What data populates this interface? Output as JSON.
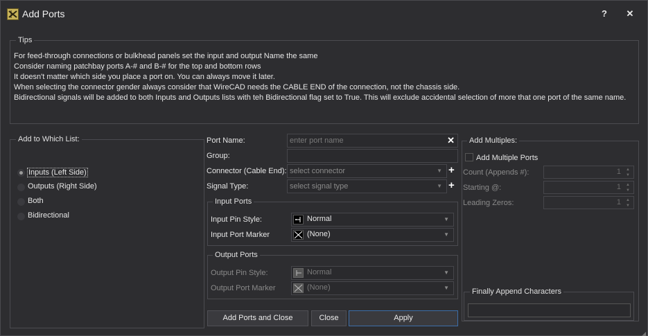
{
  "window": {
    "title": "Add Ports",
    "help": "?",
    "close": "✕"
  },
  "tips": {
    "title": "Tips",
    "lines": [
      "For feed-through connections or bulkhead panels set the input and output Name the same",
      "Consider naming patchbay ports A-# and B-# for the top and bottom rows",
      "It doesn't matter which side you place a port on. You can always move it later.",
      "When selecting the connector gender always consider that WireCAD needs the CABLE END of the connection, not the chassis side.",
      "Bidirectional signals will be added to both Inputs and Outputs lists with teh Bidirectional flag set to True. This will exclude accidental selection of more that one port of the same name."
    ]
  },
  "add_list": {
    "title": "Add to Which List:",
    "options": [
      "Inputs (Left Side)",
      "Outputs (Right Side)",
      "Both",
      "Bidirectional"
    ],
    "selected": "Inputs (Left Side)"
  },
  "form": {
    "port_name_label": "Port Name:",
    "port_name_placeholder": "enter port name",
    "group_label": "Group:",
    "connector_label": "Connector (Cable End):",
    "connector_placeholder": "select connector",
    "signal_label": "Signal Type:",
    "signal_placeholder": "select signal type",
    "clear": "✕",
    "add": "+"
  },
  "input_ports": {
    "title": "Input Ports",
    "pin_style_label": "Input Pin Style:",
    "pin_style_value": "Normal",
    "marker_label": "Input Port Marker",
    "marker_value": "(None)"
  },
  "output_ports": {
    "title": "Output Ports",
    "pin_style_label": "Output Pin Style:",
    "pin_style_value": "Normal",
    "marker_label": "Output Port Marker",
    "marker_value": "(None)"
  },
  "buttons": {
    "add_close": "Add Ports and Close",
    "close": "Close",
    "apply": "Apply"
  },
  "multiples": {
    "title": "Add Multiples:",
    "checkbox_label": "Add Multiple Ports",
    "checked": false,
    "count_label": "Count (Appends #):",
    "count_value": "1",
    "starting_label": "Starting @:",
    "starting_value": "1",
    "leading_label": "Leading Zeros:",
    "leading_value": "1",
    "append_title": "Finally Append Characters"
  },
  "colors": {
    "background": "#2d2d30",
    "border": "#4b4b50",
    "accent": "#3d6ea8",
    "icon": "#c8b35a"
  }
}
